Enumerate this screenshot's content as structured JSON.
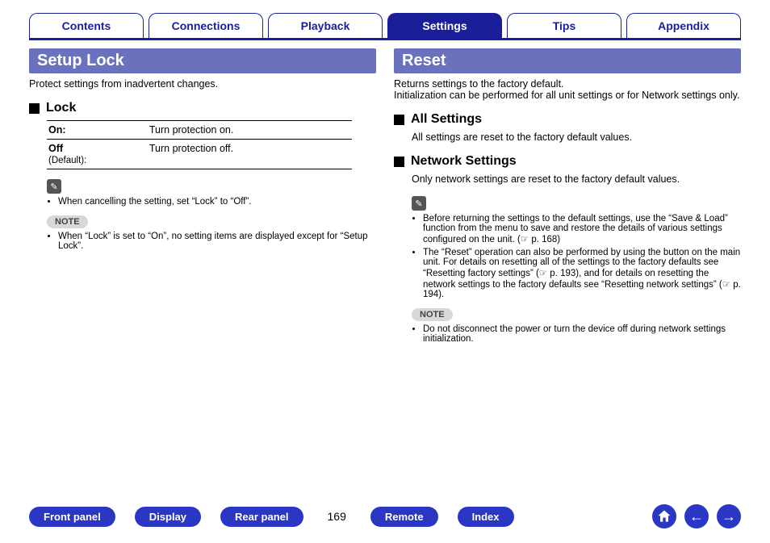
{
  "tabs": {
    "contents": "Contents",
    "connections": "Connections",
    "playback": "Playback",
    "settings": "Settings",
    "tips": "Tips",
    "appendix": "Appendix"
  },
  "left": {
    "title": "Setup Lock",
    "intro": "Protect settings from inadvertent changes.",
    "lock_heading": "Lock",
    "row_on_key": "On:",
    "row_on_val": "Turn protection on.",
    "row_off_key": "Off",
    "row_off_default": "(Default):",
    "row_off_val": "Turn protection off.",
    "pencil_bullet": "When cancelling the setting, set “Lock” to “Off”.",
    "note_label": "NOTE",
    "note_bullet": "When “Lock” is set to “On”, no setting items are displayed except for “Setup Lock”."
  },
  "right": {
    "title": "Reset",
    "intro": "Returns settings to the factory default.\nInitialization can be performed for all unit settings or for Network settings only.",
    "all_heading": "All Settings",
    "all_desc": "All settings are reset to the factory default values.",
    "net_heading": "Network Settings",
    "net_desc": "Only network settings are reset to the factory default values.",
    "pencil_b1": "Before returning the settings to the default settings, use the “Save & Load” function from the menu to save and restore the details of various settings configured on the unit. (☞ p. 168)",
    "pencil_b2": "The “Reset” operation can also be performed by using the button on the main unit. For details on resetting all of the settings to the factory defaults see “Resetting factory settings” (☞ p. 193), and for details on resetting the network settings to the factory defaults see “Resetting network settings” (☞ p. 194).",
    "note_label": "NOTE",
    "note_bullet": "Do not disconnect the power or turn the device off during network settings initialization."
  },
  "footer": {
    "front": "Front panel",
    "display": "Display",
    "rear": "Rear panel",
    "page": "169",
    "remote": "Remote",
    "index": "Index"
  }
}
